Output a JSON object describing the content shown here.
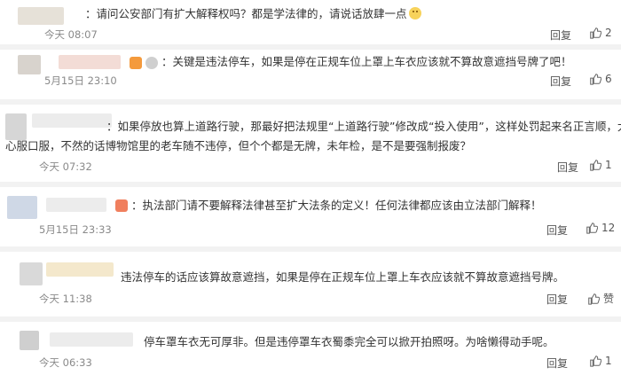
{
  "comments": [
    {
      "text": "：请问公安部门有扩大解释权吗？都是学法律的，请说话放肆一点",
      "time": "今天 08:07",
      "reply_label": "回复",
      "like_count": "2"
    },
    {
      "text": "：关键是违法停车，如果是停在正规车位上罩上车衣应该就不算故意遮挡号牌了吧！",
      "time": "5月15日 23:10",
      "reply_label": "回复",
      "like_count": "6"
    },
    {
      "text_line1": "：如果停放也算上道路行驶，那最好把法规里“上道路行驶”修改成“投入使用”，这样处罚起来名正言顺，大家也",
      "text_line2": "心服口服，不然的话博物馆里的老车随不违停，但个个都是无牌，未年检，是不是要强制报废？",
      "time": "今天 07:32",
      "reply_label": "回复",
      "like_count": "1"
    },
    {
      "text": "：执法部门请不要解释法律甚至扩大法条的定义！任何法律都应该由立法部门解释！",
      "time": "5月15日 23:33",
      "reply_label": "回复",
      "like_count": "12"
    },
    {
      "text": "违法停车的话应该算故意遮挡，如果是停在正规车位上罩上车衣应该就不算故意遮挡号牌。",
      "time": "今天 11:38",
      "reply_label": "回复",
      "like_count": "赞"
    },
    {
      "text": "停车罩车衣无可厚非。但是违停罩车衣蜀黍完全可以掀开拍照呀。为啥懒得动手呢。",
      "time": "今天 06:33",
      "reply_label": "回复",
      "like_count": "1"
    }
  ]
}
